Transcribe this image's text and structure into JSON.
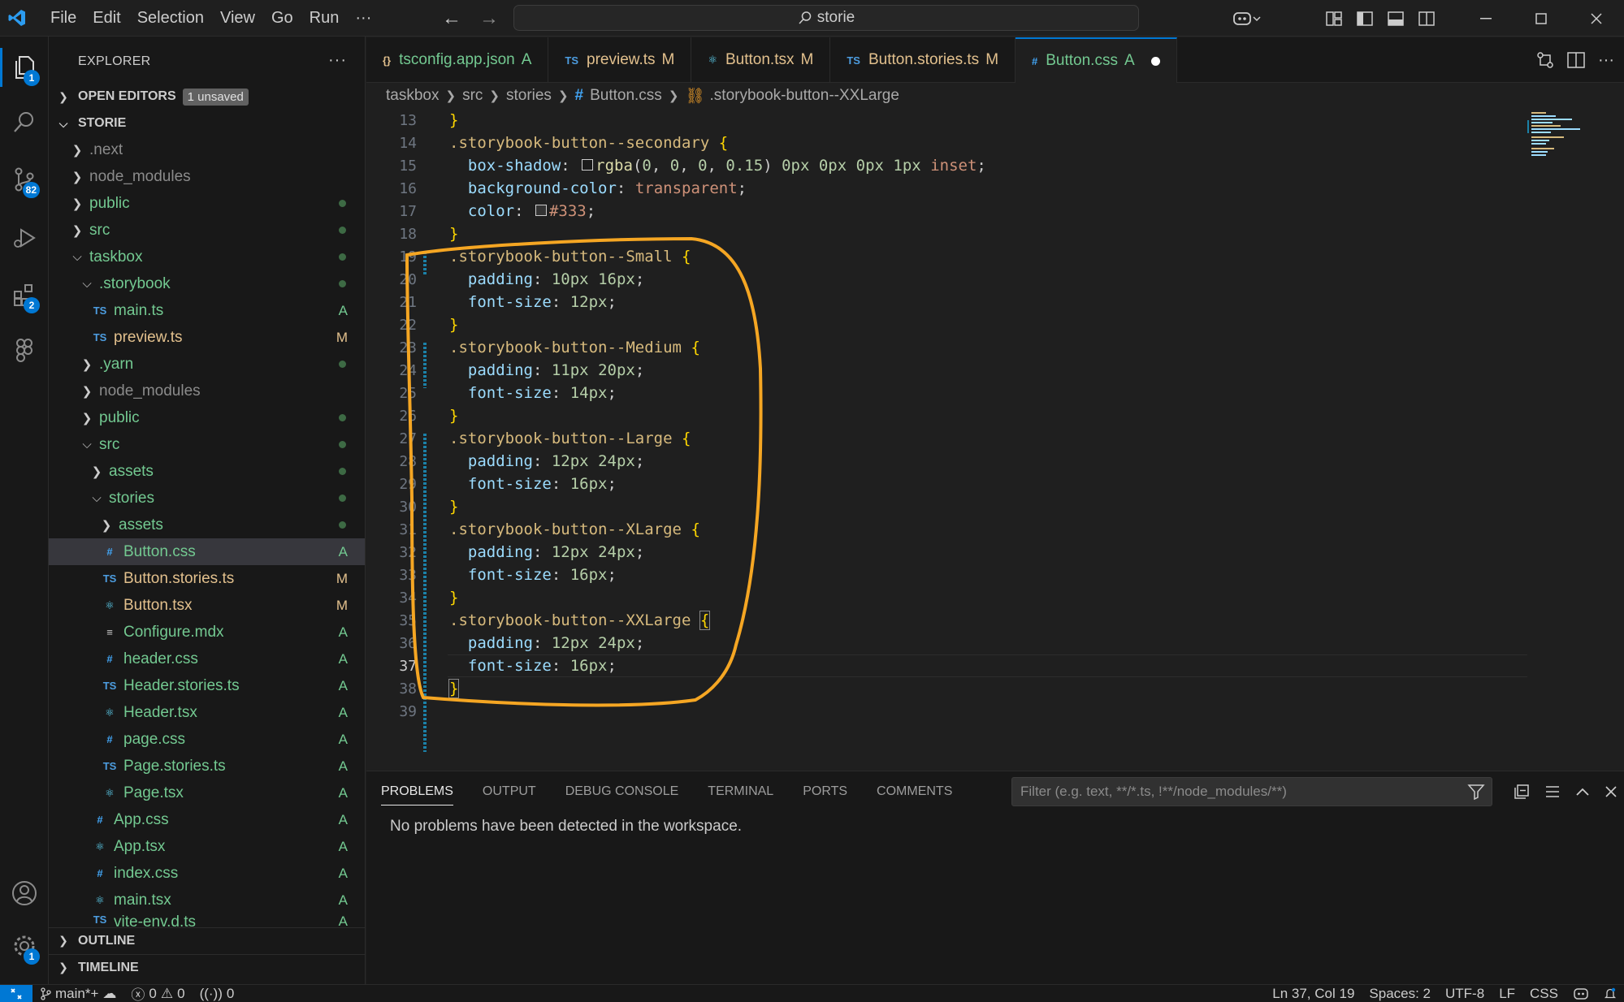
{
  "titlebar": {
    "menus": [
      "File",
      "Edit",
      "Selection",
      "View",
      "Go",
      "Run",
      "···"
    ],
    "search": "storie"
  },
  "activity": {
    "explorer_badge": "1",
    "scm_badge": "82",
    "extensions_badge": "2",
    "settings_badge": "1"
  },
  "sidebar": {
    "title": "EXPLORER",
    "more": "···",
    "open_editors": "OPEN EDITORS",
    "unsaved": "1 unsaved",
    "root": "STORIE",
    "outline": "OUTLINE",
    "timeline": "TIMELINE",
    "items": [
      {
        "label": ".next",
        "status": ""
      },
      {
        "label": "node_modules",
        "status": ""
      },
      {
        "label": "public",
        "status": "dot"
      },
      {
        "label": "src",
        "status": "dot"
      },
      {
        "label": "taskbox",
        "status": "dot"
      },
      {
        "label": ".storybook",
        "status": "dot"
      },
      {
        "label": "main.ts",
        "status": "A"
      },
      {
        "label": "preview.ts",
        "status": "M"
      },
      {
        "label": ".yarn",
        "status": "dot"
      },
      {
        "label": "node_modules",
        "status": ""
      },
      {
        "label": "public",
        "status": "dot"
      },
      {
        "label": "src",
        "status": "dot"
      },
      {
        "label": "assets",
        "status": "dot"
      },
      {
        "label": "stories",
        "status": "dot"
      },
      {
        "label": "assets",
        "status": "dot"
      },
      {
        "label": "Button.css",
        "status": "A"
      },
      {
        "label": "Button.stories.ts",
        "status": "M"
      },
      {
        "label": "Button.tsx",
        "status": "M"
      },
      {
        "label": "Configure.mdx",
        "status": "A"
      },
      {
        "label": "header.css",
        "status": "A"
      },
      {
        "label": "Header.stories.ts",
        "status": "A"
      },
      {
        "label": "Header.tsx",
        "status": "A"
      },
      {
        "label": "page.css",
        "status": "A"
      },
      {
        "label": "Page.stories.ts",
        "status": "A"
      },
      {
        "label": "Page.tsx",
        "status": "A"
      },
      {
        "label": "App.css",
        "status": "A"
      },
      {
        "label": "App.tsx",
        "status": "A"
      },
      {
        "label": "index.css",
        "status": "A"
      },
      {
        "label": "main.tsx",
        "status": "A"
      },
      {
        "label": "vite-env.d.ts",
        "status": "A"
      }
    ]
  },
  "tabs": [
    {
      "icon": "{}",
      "label": "tsconfig.app.json",
      "status": "A"
    },
    {
      "icon": "TS",
      "label": "preview.ts",
      "status": "M"
    },
    {
      "icon": "⚛",
      "label": "Button.tsx",
      "status": "M"
    },
    {
      "icon": "TS",
      "label": "Button.stories.ts",
      "status": "M"
    },
    {
      "icon": "#",
      "label": "Button.css",
      "status": "A"
    }
  ],
  "breadcrumb": [
    "taskbox",
    "src",
    "stories",
    "Button.css",
    ".storybook-button--XXLarge"
  ],
  "code": {
    "lines": [
      {
        "n": "13",
        "t": "}"
      },
      {
        "n": "14",
        "t": ".storybook-button--secondary {"
      },
      {
        "n": "15",
        "t": "  box-shadow: rgba(0, 0, 0, 0.15) 0px 0px 0px 1px inset;"
      },
      {
        "n": "16",
        "t": "  background-color: transparent;"
      },
      {
        "n": "17",
        "t": "  color: #333;"
      },
      {
        "n": "18",
        "t": "}"
      },
      {
        "n": "19",
        "t": ".storybook-button--Small {"
      },
      {
        "n": "20",
        "t": "  padding: 10px 16px;"
      },
      {
        "n": "21",
        "t": "  font-size: 12px;"
      },
      {
        "n": "22",
        "t": "}"
      },
      {
        "n": "23",
        "t": ".storybook-button--Medium {"
      },
      {
        "n": "24",
        "t": "  padding: 11px 20px;"
      },
      {
        "n": "25",
        "t": "  font-size: 14px;"
      },
      {
        "n": "26",
        "t": "}"
      },
      {
        "n": "27",
        "t": ".storybook-button--Large {"
      },
      {
        "n": "28",
        "t": "  padding: 12px 24px;"
      },
      {
        "n": "29",
        "t": "  font-size: 16px;"
      },
      {
        "n": "30",
        "t": "}"
      },
      {
        "n": "31",
        "t": ".storybook-button--XLarge {"
      },
      {
        "n": "32",
        "t": "  padding: 12px 24px;"
      },
      {
        "n": "33",
        "t": "  font-size: 16px;"
      },
      {
        "n": "34",
        "t": "}"
      },
      {
        "n": "35",
        "t": ".storybook-button--XXLarge {"
      },
      {
        "n": "36",
        "t": "  padding: 12px 24px;"
      },
      {
        "n": "37",
        "t": "  font-size: 16px;"
      },
      {
        "n": "38",
        "t": "}"
      },
      {
        "n": "39",
        "t": ""
      }
    ]
  },
  "panel": {
    "tabs": [
      "PROBLEMS",
      "OUTPUT",
      "DEBUG CONSOLE",
      "TERMINAL",
      "PORTS",
      "COMMENTS"
    ],
    "filter_placeholder": "Filter (e.g. text, **/*.ts, !**/node_modules/**)",
    "message": "No problems have been detected in the workspace."
  },
  "status": {
    "branch": "main*+",
    "errors": "0",
    "warnings": "0",
    "ports": "0",
    "position": "Ln 37, Col 19",
    "spaces": "Spaces: 2",
    "encoding": "UTF-8",
    "eol": "LF",
    "language": "CSS"
  },
  "colors": {
    "accent": "#0078d4",
    "annotation": "#f5a623",
    "modified": "#e2c08d",
    "added": "#73c991"
  }
}
